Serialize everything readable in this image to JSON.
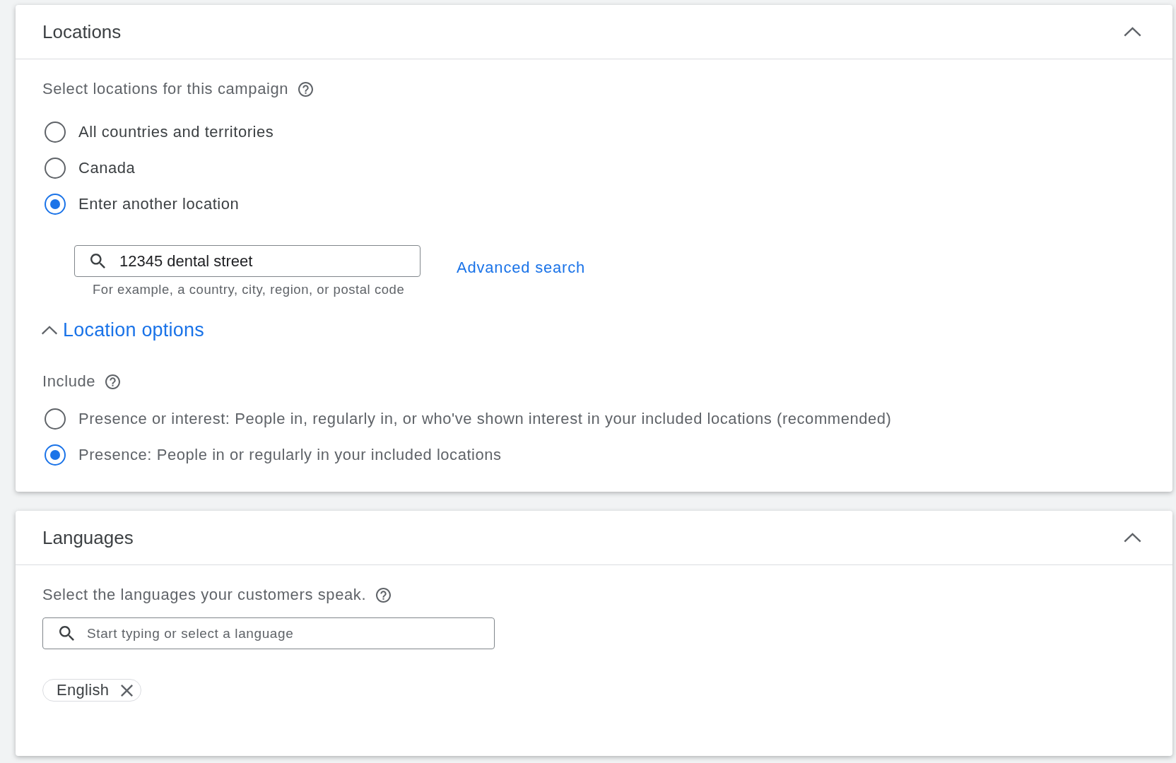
{
  "locations_panel": {
    "title": "Locations",
    "expanded": true,
    "prompt": "Select locations for this campaign",
    "location_choices": [
      {
        "label": "All countries and territories",
        "selected": false
      },
      {
        "label": "Canada",
        "selected": false
      },
      {
        "label": "Enter another location",
        "selected": true
      }
    ],
    "location_search": {
      "value": "12345 dental street",
      "helper_text": "For example, a country, city, region, or postal code"
    },
    "advanced_search_link": "Advanced search",
    "location_options": {
      "label": "Location options",
      "expanded": true,
      "include_label": "Include",
      "include_choices": [
        {
          "label": "Presence or interest: People in, regularly in, or who've shown interest in your included locations (recommended)",
          "selected": false
        },
        {
          "label": "Presence: People in or regularly in your included locations",
          "selected": true
        }
      ]
    }
  },
  "languages_panel": {
    "title": "Languages",
    "expanded": true,
    "prompt": "Select the languages your customers speak.",
    "language_search": {
      "placeholder": "Start typing or select a language"
    },
    "selected_languages": [
      {
        "label": "English"
      }
    ]
  }
}
